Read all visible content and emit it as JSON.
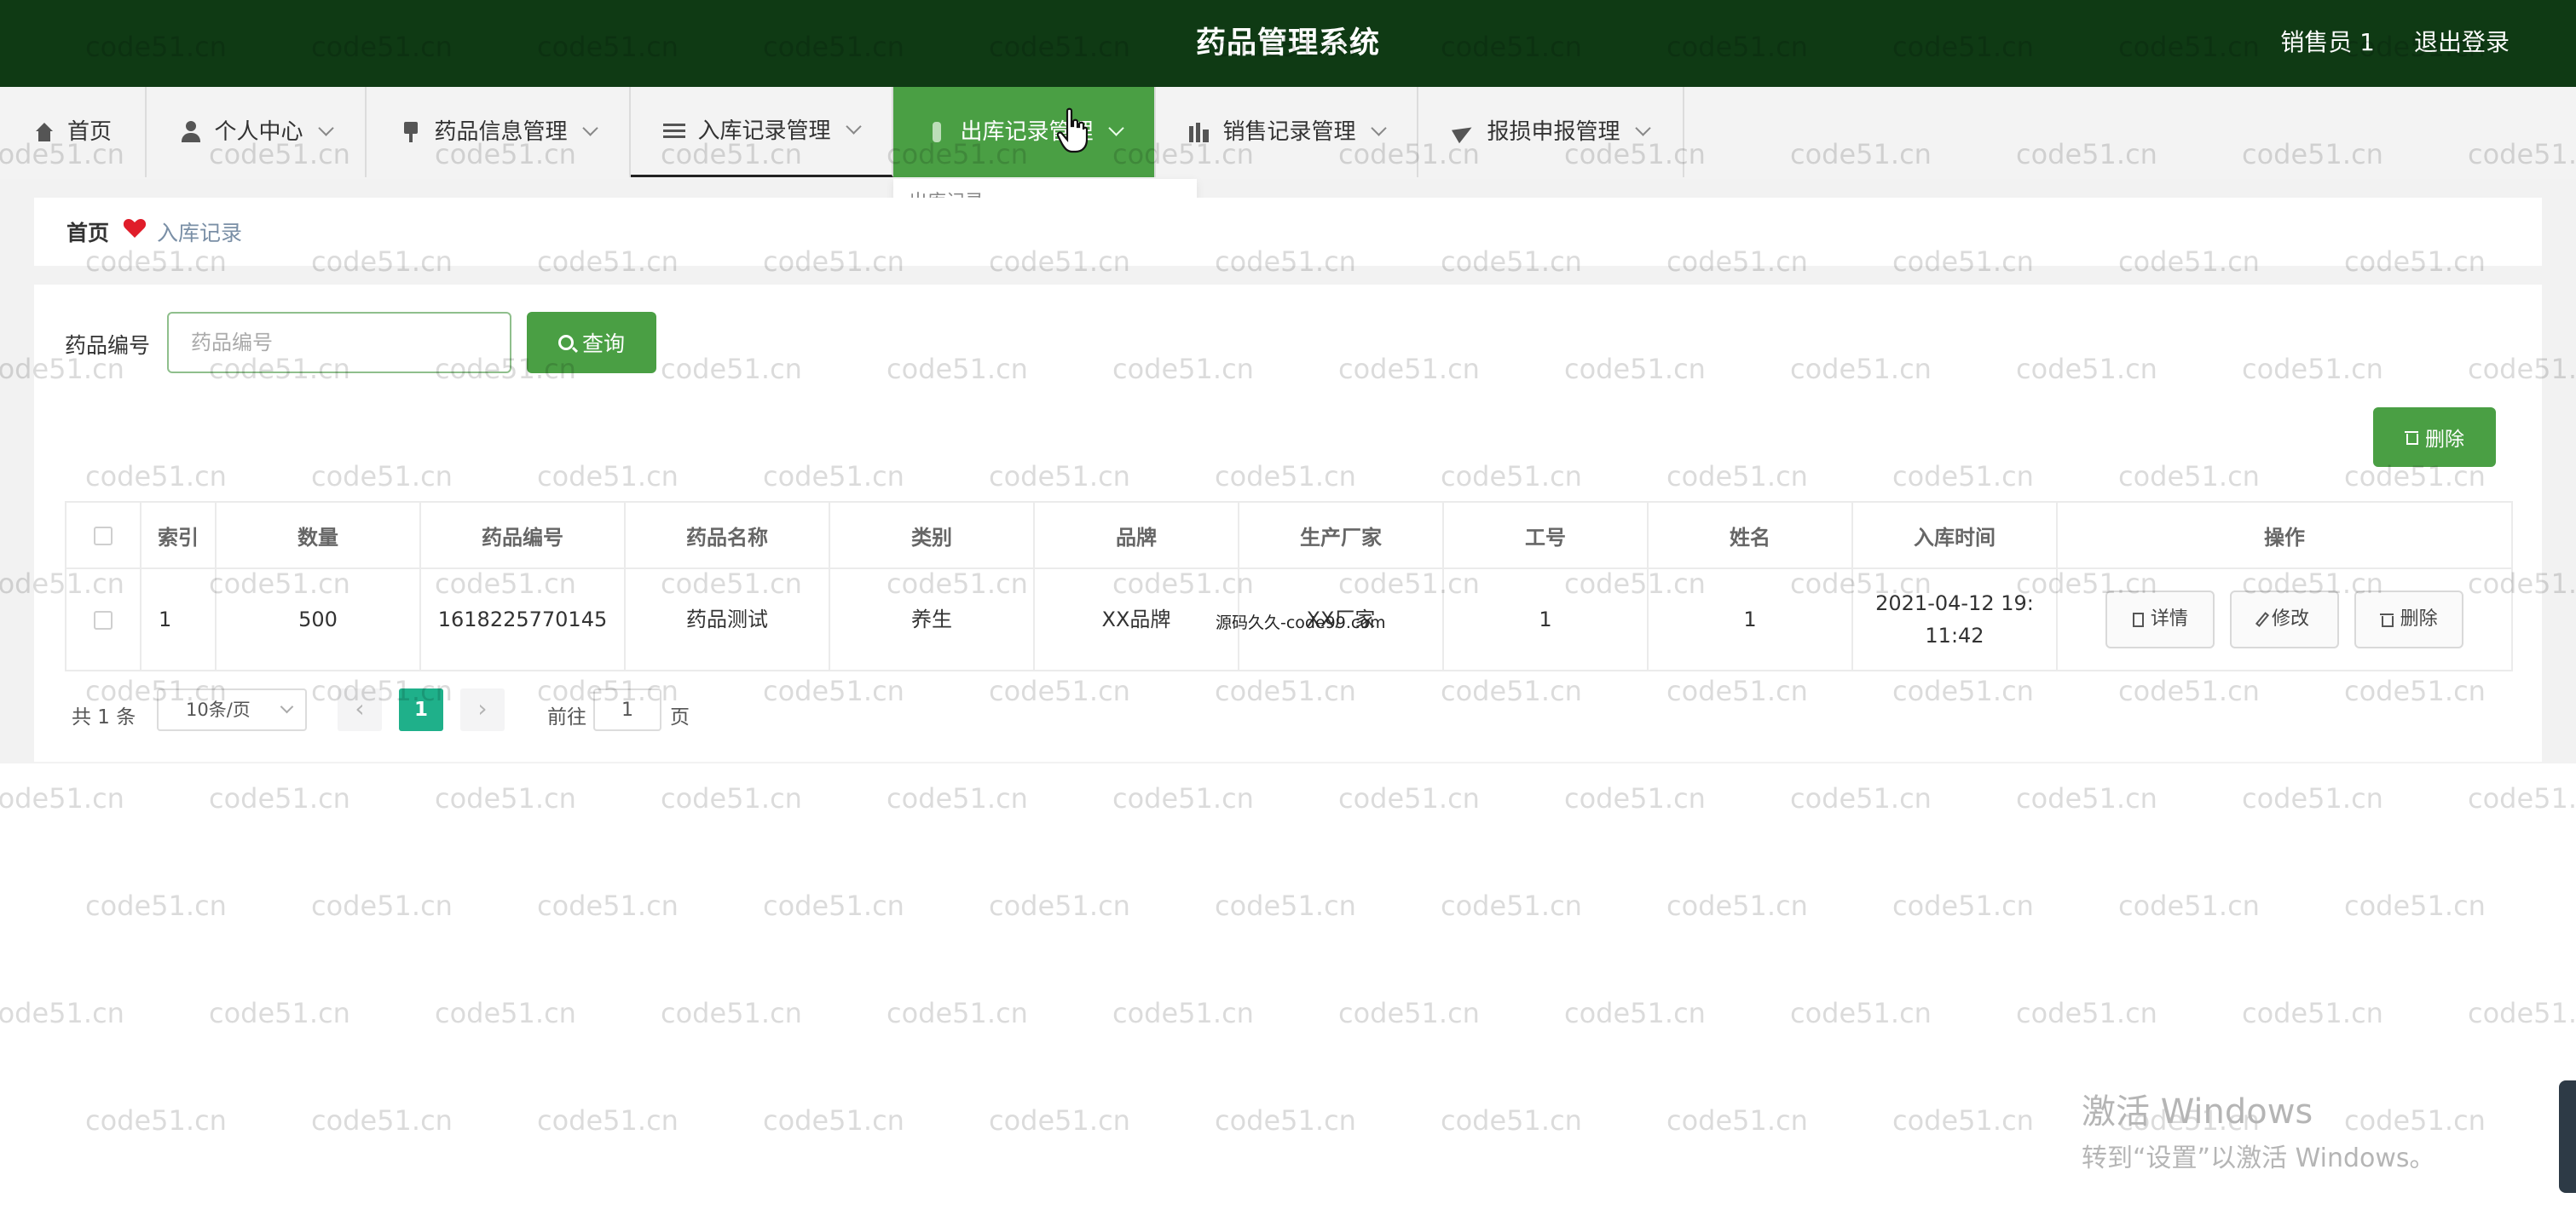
{
  "header": {
    "title": "药品管理系统",
    "user_label": "销售员 1",
    "logout_label": "退出登录"
  },
  "nav": {
    "items": [
      {
        "label": "首页",
        "icon": "home-icon"
      },
      {
        "label": "个人中心",
        "icon": "user-icon"
      },
      {
        "label": "药品信息管理",
        "icon": "medicine-icon"
      },
      {
        "label": "入库记录管理",
        "icon": "list-icon"
      },
      {
        "label": "出库记录管理",
        "icon": "outbound-icon"
      },
      {
        "label": "销售记录管理",
        "icon": "chart-icon"
      },
      {
        "label": "报损申报管理",
        "icon": "send-icon"
      }
    ],
    "active_dropdown_item": "出库记录"
  },
  "breadcrumb": {
    "home": "首页",
    "current": "入库记录"
  },
  "search": {
    "label": "药品编号",
    "placeholder": "药品编号",
    "button_label": "查询"
  },
  "toolbar": {
    "delete_label": "删除"
  },
  "table": {
    "columns": [
      "索引",
      "数量",
      "药品编号",
      "药品名称",
      "类别",
      "品牌",
      "生产厂家",
      "工号",
      "姓名",
      "入库时间",
      "操作"
    ],
    "rows": [
      {
        "index": "1",
        "quantity": "500",
        "drug_code": "1618225770145",
        "drug_name": "药品测试",
        "category": "养生",
        "brand": "XX品牌",
        "manufacturer": "XX厂家",
        "employee_id": "1",
        "name": "1",
        "time": "2021-04-12 19:11:42"
      }
    ],
    "actions": {
      "detail": "详情",
      "edit": "修改",
      "delete": "删除"
    }
  },
  "pagination": {
    "total": "共 1 条",
    "page_size": "10条/页",
    "current_page": "1",
    "goto_label": "前往",
    "jump_value": "1",
    "page_suffix": "页"
  },
  "watermark": {
    "text": "code51.cn",
    "site_text": "源码久久-code99.com"
  },
  "windows": {
    "activate_title": "激活 Windows",
    "activate_sub": "转到“设置”以激活 Windows。"
  },
  "colors": {
    "header_bg": "#0f3a14",
    "accent": "#4a9f44",
    "page_active": "#1fb08a"
  }
}
